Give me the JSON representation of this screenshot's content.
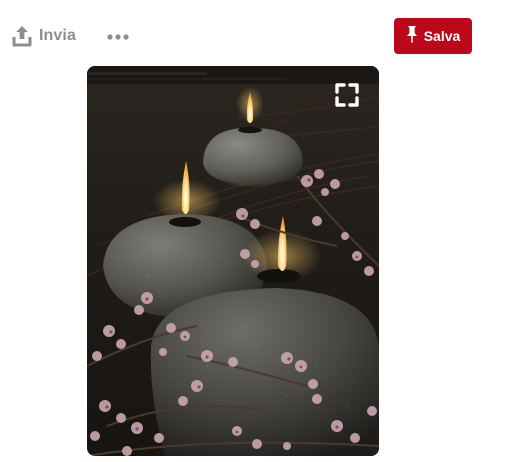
{
  "toolbar": {
    "send_label": "Invia",
    "send_icon": "upload-icon",
    "more_icon": "ellipsis-icon",
    "save_label": "Salva",
    "save_icon": "pushpin-icon"
  },
  "pin": {
    "expand_icon": "expand-fullscreen-icon"
  },
  "colors": {
    "save_button": "#bd081c",
    "muted_text": "#8e8e8e"
  }
}
